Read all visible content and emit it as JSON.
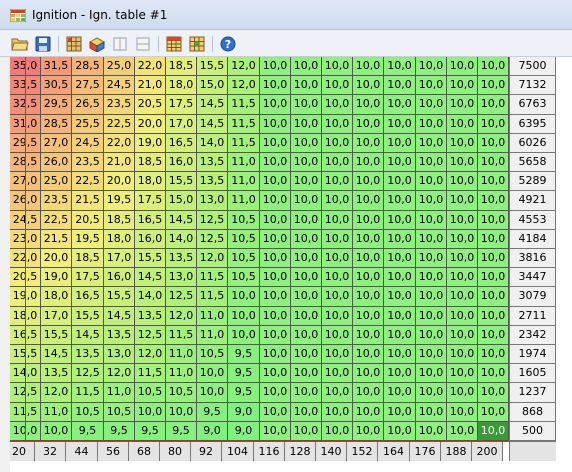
{
  "window": {
    "title": "Ignition - Ign. table #1"
  },
  "toolbar": {
    "buttons": [
      {
        "name": "open-button",
        "icon": "folder-open-icon"
      },
      {
        "name": "save-button",
        "icon": "floppy-disk-icon"
      },
      {
        "name": "grid-button",
        "icon": "grid-icon"
      },
      {
        "name": "3d-view-button",
        "icon": "cube-3d-icon"
      },
      {
        "name": "vertical-split-button",
        "icon": "vertical-split-icon"
      },
      {
        "name": "horizontal-split-button",
        "icon": "horizontal-split-icon"
      },
      {
        "name": "table-button",
        "icon": "table-icon"
      },
      {
        "name": "table-edit-button",
        "icon": "table-edit-icon"
      },
      {
        "name": "help-button",
        "icon": "help-icon"
      }
    ]
  },
  "table": {
    "rpm": [
      "7500",
      "7132",
      "6763",
      "6395",
      "6026",
      "5658",
      "5289",
      "4921",
      "4553",
      "4184",
      "3816",
      "3447",
      "3079",
      "2711",
      "2342",
      "1974",
      "1605",
      "1237",
      "868",
      "500"
    ],
    "load": [
      "20",
      "32",
      "44",
      "56",
      "68",
      "80",
      "92",
      "104",
      "116",
      "128",
      "140",
      "152",
      "164",
      "176",
      "188",
      "200"
    ],
    "rows": [
      [
        "35,0",
        "31,5",
        "28,5",
        "25,0",
        "22,0",
        "18,5",
        "15,5",
        "12,0",
        "10,0",
        "10,0",
        "10,0",
        "10,0",
        "10,0",
        "10,0",
        "10,0",
        "10,0"
      ],
      [
        "33,5",
        "30,5",
        "27,5",
        "24,5",
        "21,0",
        "18,0",
        "15,0",
        "12,0",
        "10,0",
        "10,0",
        "10,0",
        "10,0",
        "10,0",
        "10,0",
        "10,0",
        "10,0"
      ],
      [
        "32,5",
        "29,5",
        "26,5",
        "23,5",
        "20,5",
        "17,5",
        "14,5",
        "11,5",
        "10,0",
        "10,0",
        "10,0",
        "10,0",
        "10,0",
        "10,0",
        "10,0",
        "10,0"
      ],
      [
        "31,0",
        "28,5",
        "25,5",
        "22,5",
        "20,0",
        "17,0",
        "14,5",
        "11,5",
        "10,0",
        "10,0",
        "10,0",
        "10,0",
        "10,0",
        "10,0",
        "10,0",
        "10,0"
      ],
      [
        "29,5",
        "27,0",
        "24,5",
        "22,0",
        "19,0",
        "16,5",
        "14,0",
        "11,5",
        "10,0",
        "10,0",
        "10,0",
        "10,0",
        "10,0",
        "10,0",
        "10,0",
        "10,0"
      ],
      [
        "28,5",
        "26,0",
        "23,5",
        "21,0",
        "18,5",
        "16,0",
        "13,5",
        "11,0",
        "10,0",
        "10,0",
        "10,0",
        "10,0",
        "10,0",
        "10,0",
        "10,0",
        "10,0"
      ],
      [
        "27,0",
        "25,0",
        "22,5",
        "20,0",
        "18,0",
        "15,5",
        "13,5",
        "11,0",
        "10,0",
        "10,0",
        "10,0",
        "10,0",
        "10,0",
        "10,0",
        "10,0",
        "10,0"
      ],
      [
        "26,0",
        "23,5",
        "21,5",
        "19,5",
        "17,5",
        "15,0",
        "13,0",
        "11,0",
        "10,0",
        "10,0",
        "10,0",
        "10,0",
        "10,0",
        "10,0",
        "10,0",
        "10,0"
      ],
      [
        "24,5",
        "22,5",
        "20,5",
        "18,5",
        "16,5",
        "14,5",
        "12,5",
        "10,5",
        "10,0",
        "10,0",
        "10,0",
        "10,0",
        "10,0",
        "10,0",
        "10,0",
        "10,0"
      ],
      [
        "23,0",
        "21,5",
        "19,5",
        "18,0",
        "16,0",
        "14,0",
        "12,5",
        "10,5",
        "10,0",
        "10,0",
        "10,0",
        "10,0",
        "10,0",
        "10,0",
        "10,0",
        "10,0"
      ],
      [
        "22,0",
        "20,0",
        "18,5",
        "17,0",
        "15,5",
        "13,5",
        "12,0",
        "10,5",
        "10,0",
        "10,0",
        "10,0",
        "10,0",
        "10,0",
        "10,0",
        "10,0",
        "10,0"
      ],
      [
        "20,5",
        "19,0",
        "17,5",
        "16,0",
        "14,5",
        "13,0",
        "11,5",
        "10,5",
        "10,0",
        "10,0",
        "10,0",
        "10,0",
        "10,0",
        "10,0",
        "10,0",
        "10,0"
      ],
      [
        "19,0",
        "18,0",
        "16,5",
        "15,5",
        "14,0",
        "12,5",
        "11,5",
        "10,0",
        "10,0",
        "10,0",
        "10,0",
        "10,0",
        "10,0",
        "10,0",
        "10,0",
        "10,0"
      ],
      [
        "18,0",
        "17,0",
        "15,5",
        "14,5",
        "13,5",
        "12,0",
        "11,0",
        "10,0",
        "10,0",
        "10,0",
        "10,0",
        "10,0",
        "10,0",
        "10,0",
        "10,0",
        "10,0"
      ],
      [
        "16,5",
        "15,5",
        "14,5",
        "13,5",
        "12,5",
        "11,5",
        "11,0",
        "10,0",
        "10,0",
        "10,0",
        "10,0",
        "10,0",
        "10,0",
        "10,0",
        "10,0",
        "10,0"
      ],
      [
        "15,5",
        "14,5",
        "13,5",
        "13,0",
        "12,0",
        "11,0",
        "10,5",
        "9,5",
        "10,0",
        "10,0",
        "10,0",
        "10,0",
        "10,0",
        "10,0",
        "10,0",
        "10,0"
      ],
      [
        "14,0",
        "13,5",
        "12,5",
        "12,0",
        "11,5",
        "11,0",
        "10,0",
        "9,5",
        "10,0",
        "10,0",
        "10,0",
        "10,0",
        "10,0",
        "10,0",
        "10,0",
        "10,0"
      ],
      [
        "12,5",
        "12,0",
        "11,5",
        "11,0",
        "10,5",
        "10,5",
        "10,0",
        "9,5",
        "10,0",
        "10,0",
        "10,0",
        "10,0",
        "10,0",
        "10,0",
        "10,0",
        "10,0"
      ],
      [
        "11,5",
        "11,0",
        "10,5",
        "10,5",
        "10,0",
        "10,0",
        "9,5",
        "9,0",
        "10,0",
        "10,0",
        "10,0",
        "10,0",
        "10,0",
        "10,0",
        "10,0",
        "10,0"
      ],
      [
        "10,0",
        "10,0",
        "9,5",
        "9,5",
        "9,5",
        "9,5",
        "9,0",
        "9,0",
        "10,0",
        "10,0",
        "10,0",
        "10,0",
        "10,0",
        "10,0",
        "10,0",
        "10,0"
      ]
    ],
    "selected_cell": {
      "row": 19,
      "col": 15
    },
    "colors": {
      "hot": "#f07b78",
      "warm": "#f5b97a",
      "mid": "#f2ee7c",
      "cool": "#aaf07a",
      "base": "#80f080",
      "selected": "#3a9a3a",
      "marker": "#c8322d"
    }
  }
}
